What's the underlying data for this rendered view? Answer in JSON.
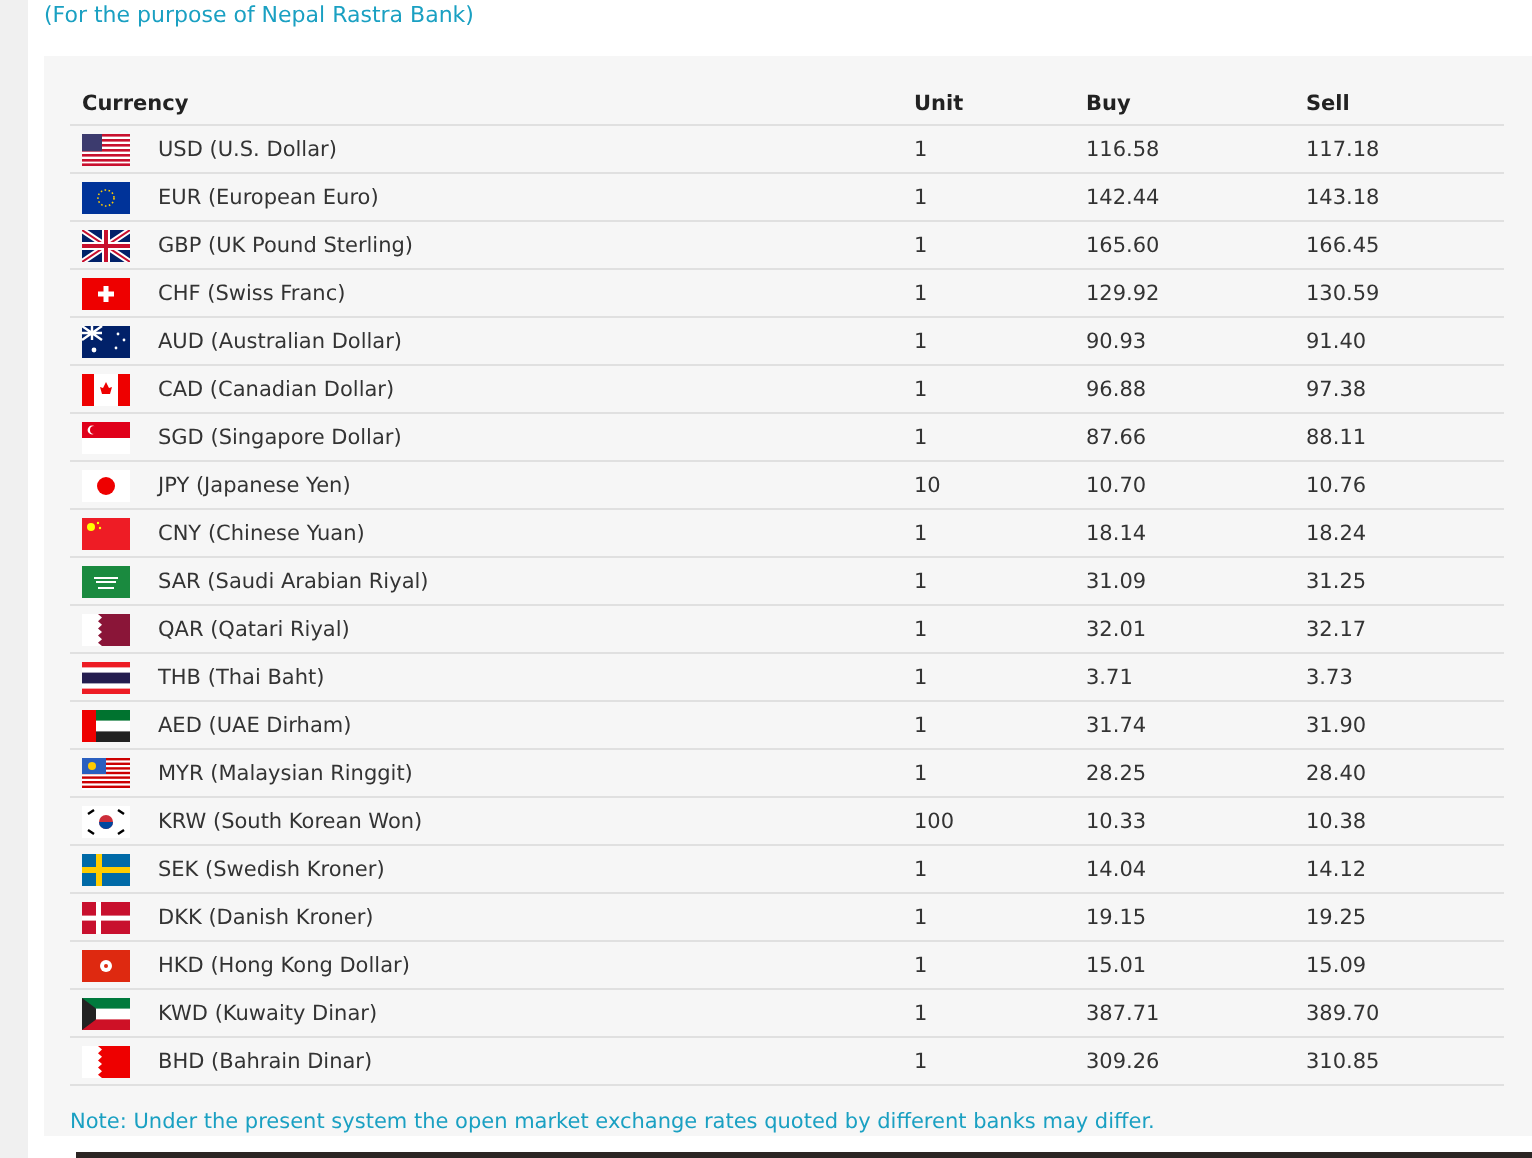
{
  "subtitle": "(For the purpose of Nepal Rastra Bank)",
  "table": {
    "columns": [
      "Currency",
      "Unit",
      "Buy",
      "Sell"
    ],
    "rows": [
      {
        "currency": "USD (U.S. Dollar)",
        "unit": "1",
        "buy": "116.58",
        "sell": "117.18"
      },
      {
        "currency": "EUR (European Euro)",
        "unit": "1",
        "buy": "142.44",
        "sell": "143.18"
      },
      {
        "currency": "GBP (UK Pound Sterling)",
        "unit": "1",
        "buy": "165.60",
        "sell": "166.45"
      },
      {
        "currency": "CHF (Swiss Franc)",
        "unit": "1",
        "buy": "129.92",
        "sell": "130.59"
      },
      {
        "currency": "AUD (Australian Dollar)",
        "unit": "1",
        "buy": "90.93",
        "sell": "91.40"
      },
      {
        "currency": "CAD (Canadian Dollar)",
        "unit": "1",
        "buy": "96.88",
        "sell": "97.38"
      },
      {
        "currency": "SGD (Singapore Dollar)",
        "unit": "1",
        "buy": "87.66",
        "sell": "88.11"
      },
      {
        "currency": "JPY (Japanese Yen)",
        "unit": "10",
        "buy": "10.70",
        "sell": "10.76"
      },
      {
        "currency": "CNY (Chinese Yuan)",
        "unit": "1",
        "buy": "18.14",
        "sell": "18.24"
      },
      {
        "currency": "SAR (Saudi Arabian Riyal)",
        "unit": "1",
        "buy": "31.09",
        "sell": "31.25"
      },
      {
        "currency": "QAR (Qatari Riyal)",
        "unit": "1",
        "buy": "32.01",
        "sell": "32.17"
      },
      {
        "currency": "THB (Thai Baht)",
        "unit": "1",
        "buy": "3.71",
        "sell": "3.73"
      },
      {
        "currency": "AED (UAE Dirham)",
        "unit": "1",
        "buy": "31.74",
        "sell": "31.90"
      },
      {
        "currency": "MYR (Malaysian Ringgit)",
        "unit": "1",
        "buy": "28.25",
        "sell": "28.40"
      },
      {
        "currency": "KRW (South Korean Won)",
        "unit": "100",
        "buy": "10.33",
        "sell": "10.38"
      },
      {
        "currency": "SEK (Swedish Kroner)",
        "unit": "1",
        "buy": "14.04",
        "sell": "14.12"
      },
      {
        "currency": "DKK (Danish Kroner)",
        "unit": "1",
        "buy": "19.15",
        "sell": "19.25"
      },
      {
        "currency": "HKD (Hong Kong Dollar)",
        "unit": "1",
        "buy": "15.01",
        "sell": "15.09"
      },
      {
        "currency": "KWD (Kuwaity Dinar)",
        "unit": "1",
        "buy": "387.71",
        "sell": "389.70"
      },
      {
        "currency": "BHD (Bahrain Dinar)",
        "unit": "1",
        "buy": "309.26",
        "sell": "310.85"
      }
    ]
  },
  "note": "Note: Under the present system the open market exchange rates quoted by different banks may differ."
}
